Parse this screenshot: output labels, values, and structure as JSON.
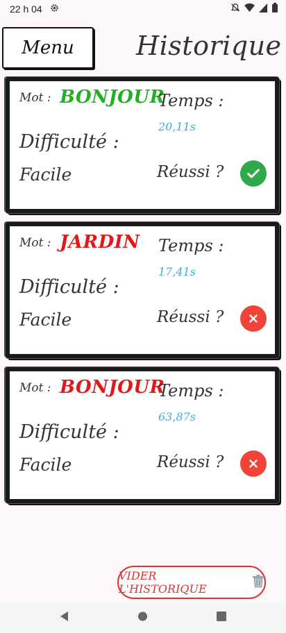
{
  "status_bar": {
    "time": "22 h 04"
  },
  "header": {
    "menu_label": "Menu",
    "title": "Historique"
  },
  "labels": {
    "mot": "Mot :",
    "temps": "Temps :",
    "difficulte": "Difficulté :",
    "reussi": "Réussi ?"
  },
  "history": [
    {
      "mot": "BONJOUR",
      "mot_color": "#22b022",
      "temps": "20,11s",
      "difficulte": "Facile",
      "reussi": true
    },
    {
      "mot": "JARDIN",
      "mot_color": "#e01818",
      "temps": "17,41s",
      "difficulte": "Facile",
      "reussi": false
    },
    {
      "mot": "BONJOUR",
      "mot_color": "#e01818",
      "temps": "63,87s",
      "difficulte": "Facile",
      "reussi": false
    }
  ],
  "clear_button": {
    "label": "VIDER L'HISTORIQUE",
    "icon": "trash-icon"
  },
  "icons": {
    "settings": "gear-icon",
    "notifications_off": "bell-off-icon",
    "wifi": "wifi-icon",
    "signal": "signal-icon",
    "battery": "battery-icon",
    "success": "check-icon",
    "failure": "close-icon",
    "nav_back": "back-icon",
    "nav_home": "home-icon",
    "nav_recents": "recents-icon"
  },
  "colors": {
    "success": "#2eaa4a",
    "failure": "#f04438",
    "time": "#3ab1d6",
    "clear_button": "#d93434"
  }
}
